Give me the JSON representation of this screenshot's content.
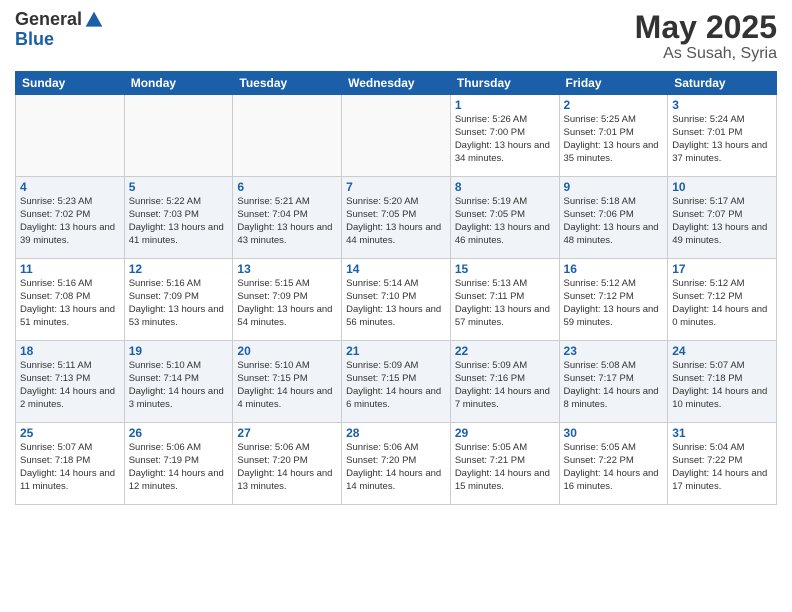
{
  "logo": {
    "general": "General",
    "blue": "Blue"
  },
  "title": {
    "month": "May 2025",
    "location": "As Susah, Syria"
  },
  "headers": [
    "Sunday",
    "Monday",
    "Tuesday",
    "Wednesday",
    "Thursday",
    "Friday",
    "Saturday"
  ],
  "weeks": [
    [
      {
        "day": "",
        "info": ""
      },
      {
        "day": "",
        "info": ""
      },
      {
        "day": "",
        "info": ""
      },
      {
        "day": "",
        "info": ""
      },
      {
        "day": "1",
        "info": "Sunrise: 5:26 AM\nSunset: 7:00 PM\nDaylight: 13 hours\nand 34 minutes."
      },
      {
        "day": "2",
        "info": "Sunrise: 5:25 AM\nSunset: 7:01 PM\nDaylight: 13 hours\nand 35 minutes."
      },
      {
        "day": "3",
        "info": "Sunrise: 5:24 AM\nSunset: 7:01 PM\nDaylight: 13 hours\nand 37 minutes."
      }
    ],
    [
      {
        "day": "4",
        "info": "Sunrise: 5:23 AM\nSunset: 7:02 PM\nDaylight: 13 hours\nand 39 minutes."
      },
      {
        "day": "5",
        "info": "Sunrise: 5:22 AM\nSunset: 7:03 PM\nDaylight: 13 hours\nand 41 minutes."
      },
      {
        "day": "6",
        "info": "Sunrise: 5:21 AM\nSunset: 7:04 PM\nDaylight: 13 hours\nand 43 minutes."
      },
      {
        "day": "7",
        "info": "Sunrise: 5:20 AM\nSunset: 7:05 PM\nDaylight: 13 hours\nand 44 minutes."
      },
      {
        "day": "8",
        "info": "Sunrise: 5:19 AM\nSunset: 7:05 PM\nDaylight: 13 hours\nand 46 minutes."
      },
      {
        "day": "9",
        "info": "Sunrise: 5:18 AM\nSunset: 7:06 PM\nDaylight: 13 hours\nand 48 minutes."
      },
      {
        "day": "10",
        "info": "Sunrise: 5:17 AM\nSunset: 7:07 PM\nDaylight: 13 hours\nand 49 minutes."
      }
    ],
    [
      {
        "day": "11",
        "info": "Sunrise: 5:16 AM\nSunset: 7:08 PM\nDaylight: 13 hours\nand 51 minutes."
      },
      {
        "day": "12",
        "info": "Sunrise: 5:16 AM\nSunset: 7:09 PM\nDaylight: 13 hours\nand 53 minutes."
      },
      {
        "day": "13",
        "info": "Sunrise: 5:15 AM\nSunset: 7:09 PM\nDaylight: 13 hours\nand 54 minutes."
      },
      {
        "day": "14",
        "info": "Sunrise: 5:14 AM\nSunset: 7:10 PM\nDaylight: 13 hours\nand 56 minutes."
      },
      {
        "day": "15",
        "info": "Sunrise: 5:13 AM\nSunset: 7:11 PM\nDaylight: 13 hours\nand 57 minutes."
      },
      {
        "day": "16",
        "info": "Sunrise: 5:12 AM\nSunset: 7:12 PM\nDaylight: 13 hours\nand 59 minutes."
      },
      {
        "day": "17",
        "info": "Sunrise: 5:12 AM\nSunset: 7:12 PM\nDaylight: 14 hours\nand 0 minutes."
      }
    ],
    [
      {
        "day": "18",
        "info": "Sunrise: 5:11 AM\nSunset: 7:13 PM\nDaylight: 14 hours\nand 2 minutes."
      },
      {
        "day": "19",
        "info": "Sunrise: 5:10 AM\nSunset: 7:14 PM\nDaylight: 14 hours\nand 3 minutes."
      },
      {
        "day": "20",
        "info": "Sunrise: 5:10 AM\nSunset: 7:15 PM\nDaylight: 14 hours\nand 4 minutes."
      },
      {
        "day": "21",
        "info": "Sunrise: 5:09 AM\nSunset: 7:15 PM\nDaylight: 14 hours\nand 6 minutes."
      },
      {
        "day": "22",
        "info": "Sunrise: 5:09 AM\nSunset: 7:16 PM\nDaylight: 14 hours\nand 7 minutes."
      },
      {
        "day": "23",
        "info": "Sunrise: 5:08 AM\nSunset: 7:17 PM\nDaylight: 14 hours\nand 8 minutes."
      },
      {
        "day": "24",
        "info": "Sunrise: 5:07 AM\nSunset: 7:18 PM\nDaylight: 14 hours\nand 10 minutes."
      }
    ],
    [
      {
        "day": "25",
        "info": "Sunrise: 5:07 AM\nSunset: 7:18 PM\nDaylight: 14 hours\nand 11 minutes."
      },
      {
        "day": "26",
        "info": "Sunrise: 5:06 AM\nSunset: 7:19 PM\nDaylight: 14 hours\nand 12 minutes."
      },
      {
        "day": "27",
        "info": "Sunrise: 5:06 AM\nSunset: 7:20 PM\nDaylight: 14 hours\nand 13 minutes."
      },
      {
        "day": "28",
        "info": "Sunrise: 5:06 AM\nSunset: 7:20 PM\nDaylight: 14 hours\nand 14 minutes."
      },
      {
        "day": "29",
        "info": "Sunrise: 5:05 AM\nSunset: 7:21 PM\nDaylight: 14 hours\nand 15 minutes."
      },
      {
        "day": "30",
        "info": "Sunrise: 5:05 AM\nSunset: 7:22 PM\nDaylight: 14 hours\nand 16 minutes."
      },
      {
        "day": "31",
        "info": "Sunrise: 5:04 AM\nSunset: 7:22 PM\nDaylight: 14 hours\nand 17 minutes."
      }
    ]
  ]
}
